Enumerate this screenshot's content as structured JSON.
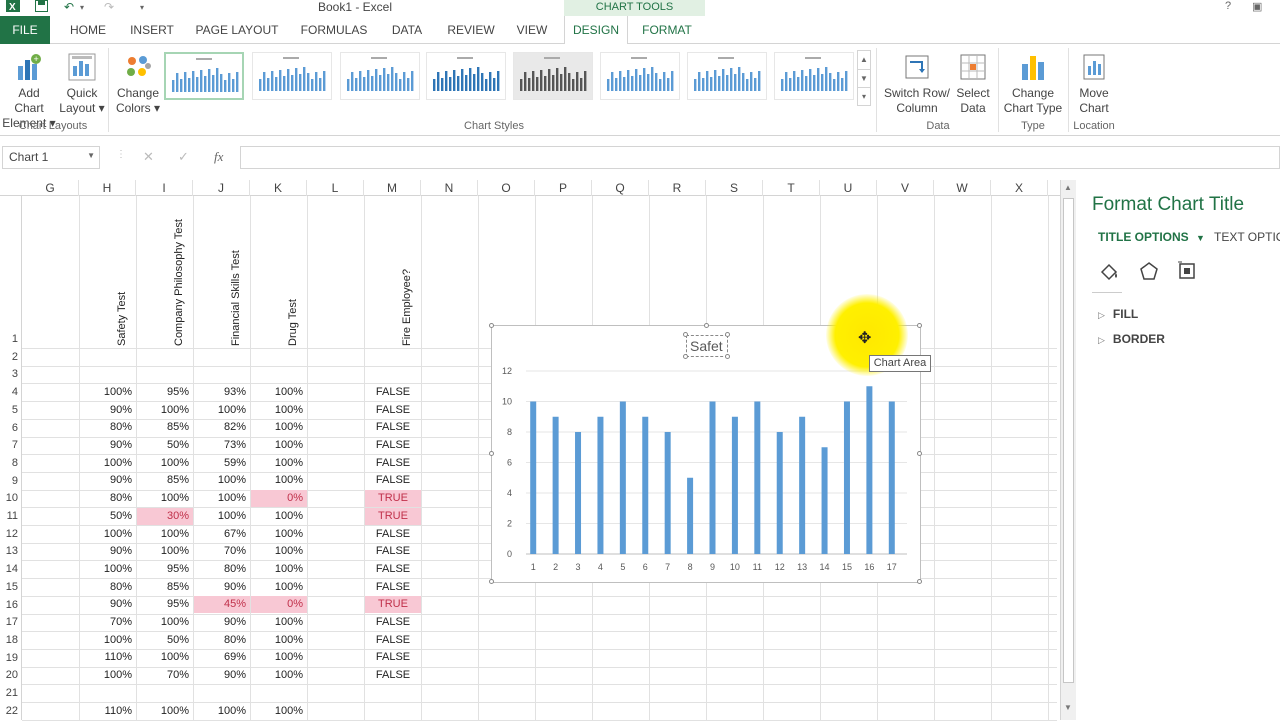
{
  "window": {
    "title": "Book1 - Excel",
    "context_band": "CHART TOOLS",
    "help_label": "?"
  },
  "tabs": [
    {
      "label": "FILE"
    },
    {
      "label": "HOME"
    },
    {
      "label": "INSERT"
    },
    {
      "label": "PAGE LAYOUT"
    },
    {
      "label": "FORMULAS"
    },
    {
      "label": "DATA"
    },
    {
      "label": "REVIEW"
    },
    {
      "label": "VIEW"
    },
    {
      "label": "DESIGN"
    },
    {
      "label": "FORMAT"
    }
  ],
  "ribbon": {
    "add_chart_element": [
      "Add Chart",
      "Element ▾"
    ],
    "quick_layout": [
      "Quick",
      "Layout ▾"
    ],
    "change_colors": [
      "Change",
      "Colors ▾"
    ],
    "switch_row_col": [
      "Switch Row/",
      "Column"
    ],
    "select_data": [
      "Select",
      "Data"
    ],
    "change_chart_type": [
      "Change",
      "Chart Type"
    ],
    "move_chart": [
      "Move",
      "Chart"
    ],
    "groups": {
      "chart_layouts": "Chart Layouts",
      "chart_styles": "Chart Styles",
      "data": "Data",
      "type": "Type",
      "location": "Location"
    }
  },
  "formula_bar": {
    "name_box": "Chart 1",
    "fx": "fx",
    "cancel": "✕",
    "enter": "✓",
    "value": ""
  },
  "grid": {
    "columns": [
      "G",
      "H",
      "I",
      "J",
      "K",
      "L",
      "M",
      "N",
      "O",
      "P",
      "Q",
      "R",
      "S",
      "T",
      "U",
      "V",
      "W",
      "X"
    ],
    "rows": [
      "1",
      "2",
      "3",
      "4",
      "5",
      "6",
      "7",
      "8",
      "9",
      "10",
      "11",
      "12",
      "13",
      "14",
      "15",
      "16",
      "17",
      "18",
      "19",
      "20",
      "21",
      "22"
    ],
    "headers": {
      "H": "Safety Test",
      "I": "Company Philosophy Test",
      "J": "Financial Skills Test",
      "K": "Drug Test",
      "M": "Fire Employee?"
    },
    "data_rows": [
      {
        "row": 4,
        "H": "100%",
        "I": "95%",
        "J": "93%",
        "K": "100%",
        "M": "FALSE"
      },
      {
        "row": 5,
        "H": "90%",
        "I": "100%",
        "J": "100%",
        "K": "100%",
        "M": "FALSE"
      },
      {
        "row": 6,
        "H": "80%",
        "I": "85%",
        "J": "82%",
        "K": "100%",
        "M": "FALSE"
      },
      {
        "row": 7,
        "H": "90%",
        "I": "50%",
        "J": "73%",
        "K": "100%",
        "M": "FALSE"
      },
      {
        "row": 8,
        "H": "100%",
        "I": "100%",
        "J": "59%",
        "K": "100%",
        "M": "FALSE"
      },
      {
        "row": 9,
        "H": "90%",
        "I": "85%",
        "J": "100%",
        "K": "100%",
        "M": "FALSE"
      },
      {
        "row": 10,
        "H": "80%",
        "I": "100%",
        "J": "100%",
        "K": "0%",
        "M": "TRUE"
      },
      {
        "row": 11,
        "H": "50%",
        "I": "30%",
        "J": "100%",
        "K": "100%",
        "M": "TRUE"
      },
      {
        "row": 12,
        "H": "100%",
        "I": "100%",
        "J": "67%",
        "K": "100%",
        "M": "FALSE"
      },
      {
        "row": 13,
        "H": "90%",
        "I": "100%",
        "J": "70%",
        "K": "100%",
        "M": "FALSE"
      },
      {
        "row": 14,
        "H": "100%",
        "I": "95%",
        "J": "80%",
        "K": "100%",
        "M": "FALSE"
      },
      {
        "row": 15,
        "H": "80%",
        "I": "85%",
        "J": "90%",
        "K": "100%",
        "M": "FALSE"
      },
      {
        "row": 16,
        "H": "90%",
        "I": "95%",
        "J": "45%",
        "K": "0%",
        "M": "TRUE"
      },
      {
        "row": 17,
        "H": "70%",
        "I": "100%",
        "J": "90%",
        "K": "100%",
        "M": "FALSE"
      },
      {
        "row": 18,
        "H": "100%",
        "I": "50%",
        "J": "80%",
        "K": "100%",
        "M": "FALSE"
      },
      {
        "row": 19,
        "H": "110%",
        "I": "100%",
        "J": "69%",
        "K": "100%",
        "M": "FALSE"
      },
      {
        "row": 20,
        "H": "100%",
        "I": "70%",
        "J": "90%",
        "K": "100%",
        "M": "FALSE"
      },
      {
        "row": 22,
        "H": "110%",
        "I": "100%",
        "J": "100%",
        "K": "100%",
        "M": ""
      }
    ],
    "highlighted_cells": [
      "K10",
      "M10",
      "I11",
      "M11",
      "J16",
      "K16",
      "M16"
    ],
    "highlight_color": "#f8c8d4",
    "highlight_text_color": "#c0304a"
  },
  "chart": {
    "title_text": "Safet",
    "tooltip": "Chart Area",
    "bar_color": "#5b9bd5"
  },
  "chart_data": {
    "type": "bar",
    "title": "Safet",
    "categories": [
      "1",
      "2",
      "3",
      "4",
      "5",
      "6",
      "7",
      "8",
      "9",
      "10",
      "11",
      "12",
      "13",
      "14",
      "15",
      "16",
      "17"
    ],
    "values": [
      10,
      9,
      8,
      9,
      10,
      9,
      8,
      5,
      10,
      9,
      10,
      8,
      9,
      7,
      10,
      11,
      10
    ],
    "yticks": [
      "0",
      "2",
      "4",
      "6",
      "8",
      "10",
      "12"
    ],
    "ylim": [
      0,
      12
    ],
    "grid": true,
    "legend": "none"
  },
  "pane": {
    "title": "Format Chart Title",
    "tab_title_options": "TITLE OPTIONS",
    "tab_text_options": "TEXT OPTIONS",
    "sections": [
      "FILL",
      "BORDER"
    ],
    "icons": [
      "fill-line-icon",
      "effects-icon",
      "size-properties-icon"
    ]
  },
  "colors": {
    "accent": "#217346",
    "context_band_bg": "#e1f0e3"
  }
}
